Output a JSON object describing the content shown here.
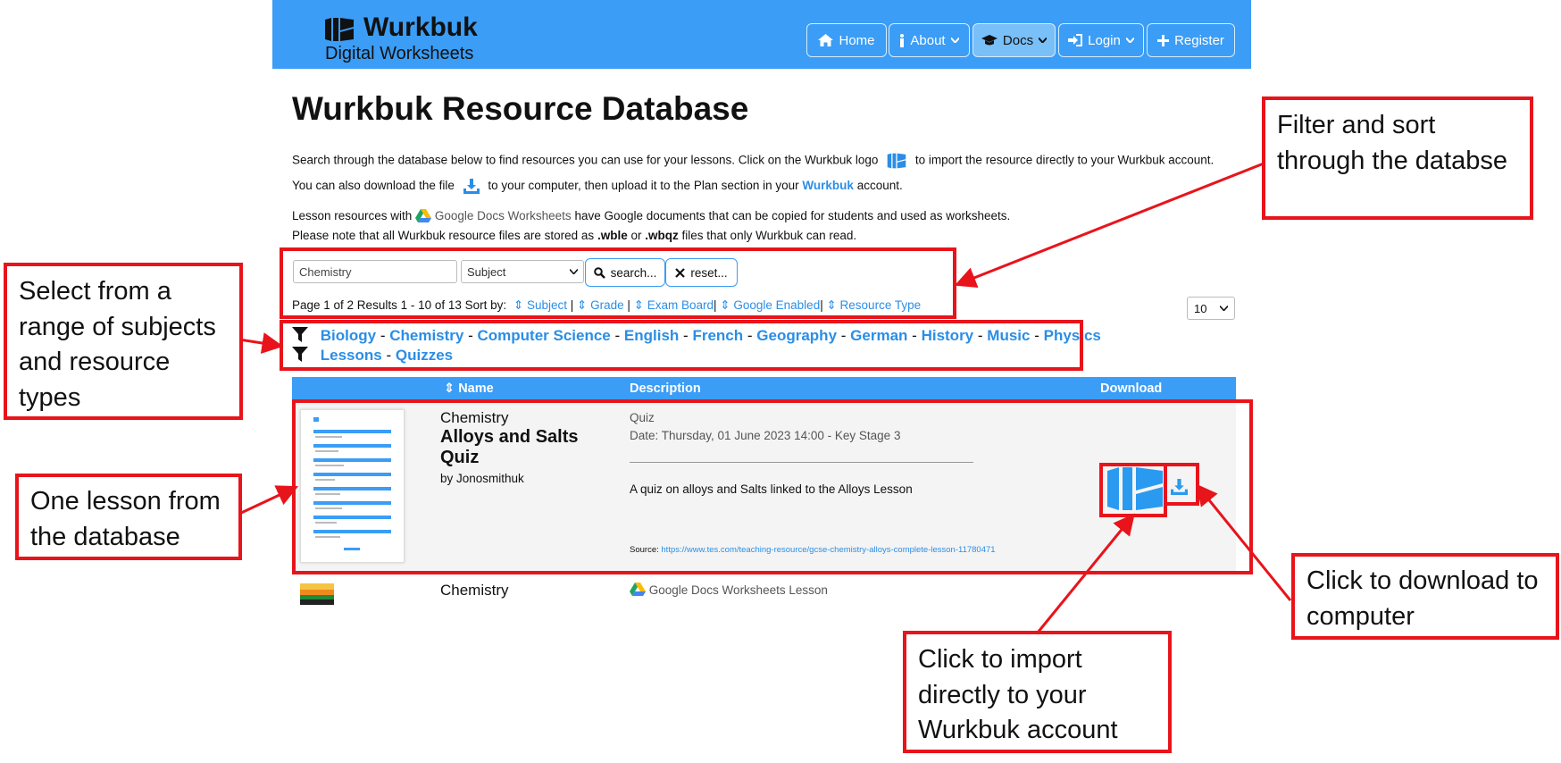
{
  "header": {
    "brand": "Wurkbuk",
    "tagline": "Digital Worksheets",
    "nav": [
      {
        "label": "Home",
        "icon": "home-icon"
      },
      {
        "label": "About",
        "icon": "info-icon"
      },
      {
        "label": "Docs",
        "icon": "graduation-cap-icon"
      },
      {
        "label": "Login",
        "icon": "sign-in-icon"
      },
      {
        "label": "Register",
        "icon": "plus-icon"
      }
    ]
  },
  "page": {
    "title": "Wurkbuk Resource Database",
    "intro1_a": "Search through the database below to find resources you can use for your lessons. Click on the Wurkbuk logo",
    "intro1_b": "to import the resource directly to your Wurkbuk account.",
    "intro2_a": "You can also download the file",
    "intro2_b": "to your computer, then upload it to the Plan section in your",
    "intro2_link": "Wurkbuk",
    "intro2_c": "account.",
    "intro3_a": "Lesson resources with",
    "intro3_google": "Google Docs Worksheets",
    "intro3_b": "have Google documents that can be copied for students and used as worksheets.",
    "intro4_a": "Please note that all Wurkbuk resource files are stored as",
    "intro4_ext1": ".wble",
    "intro4_or": "or",
    "intro4_ext2": ".wbqz",
    "intro4_b": "files that only Wurkbuk can read."
  },
  "search": {
    "value": "Chemistry",
    "subject_select": "Subject",
    "search_label": "search...",
    "reset_label": "reset...",
    "page_size": "10"
  },
  "pagination": {
    "summary": "Page 1 of 2 Results 1 - 10 of 13 Sort by:",
    "sort": [
      "Subject",
      "Grade",
      "Exam Board",
      "Google Enabled",
      "Resource Type"
    ]
  },
  "filters": {
    "subjects": [
      "Biology",
      "Chemistry",
      "Computer Science",
      "English",
      "French",
      "Geography",
      "German",
      "History",
      "Music",
      "Physics"
    ],
    "types": [
      "Lessons",
      "Quizzes"
    ]
  },
  "table": {
    "headers": {
      "name": "Name",
      "description": "Description",
      "download": "Download"
    },
    "rows": [
      {
        "subject": "Chemistry",
        "title": "Alloys and Salts Quiz",
        "author": "by Jonosmithuk",
        "type": "Quiz",
        "date": "Date: Thursday, 01 June 2023 14:00 - Key Stage 3",
        "description": "A quiz on alloys and Salts linked to the Alloys Lesson",
        "source_label": "Source:",
        "source_url": "https://www.tes.com/teaching-resource/gcse-chemistry-alloys-complete-lesson-11780471"
      },
      {
        "subject": "Chemistry",
        "type": "Google Docs Worksheets Lesson"
      }
    ]
  },
  "annotations": {
    "filter_sort": "Filter and sort through the databse",
    "select_subjects": "Select from a range of subjects and resource types",
    "one_lesson": "One lesson from the database",
    "download": "Click to download to computer",
    "import": "Click to import directly to your Wurkbuk account"
  },
  "colors": {
    "brand_blue": "#3b9df5",
    "link_blue": "#2a8ee6",
    "annotation_red": "#e8141b"
  }
}
